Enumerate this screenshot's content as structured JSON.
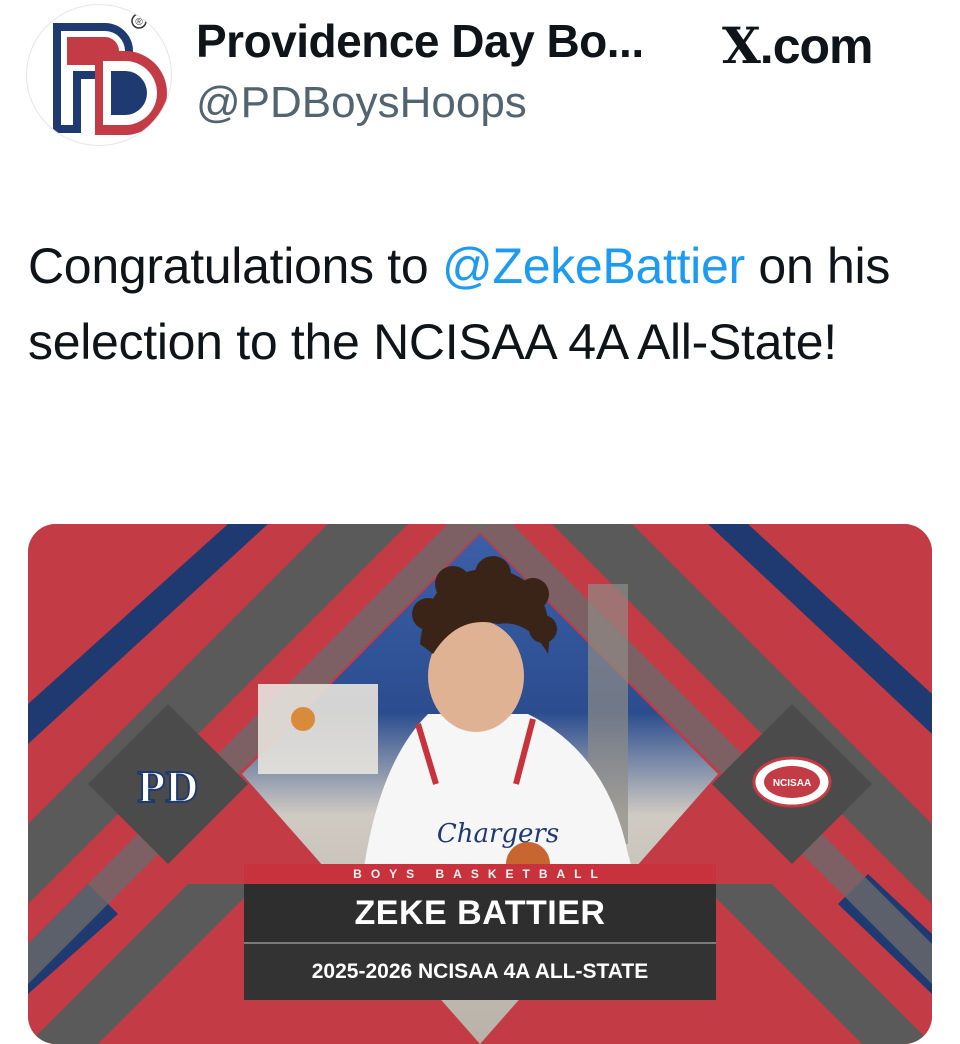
{
  "header": {
    "display_name": "Providence Day Bo...",
    "handle": "@PDBoysHoops",
    "source": {
      "prefix": "X",
      "suffix": ".com"
    },
    "logo_text": "PD",
    "logo_registered": "®"
  },
  "tweet": {
    "text_before": "Congratulations to ",
    "mention": "@ZekeBattier",
    "text_after": " on his selection to the NCISAA 4A All-State!"
  },
  "graphic": {
    "jersey_text": "Chargers",
    "pd_logo_text": "PD",
    "ncisaa_logo_text": "NCISAA",
    "banner_label": "BOYS BASKETBALL",
    "player_name": "ZEKE BATTIER",
    "honor": "2025-2026 NCISAA 4A ALL-STATE"
  },
  "colors": {
    "brand_red": "#c23b45",
    "brand_navy": "#1f3a70",
    "panel_gray": "#5c5c5c",
    "mention_blue": "#1d9bf0",
    "handle_gray": "#536471"
  }
}
